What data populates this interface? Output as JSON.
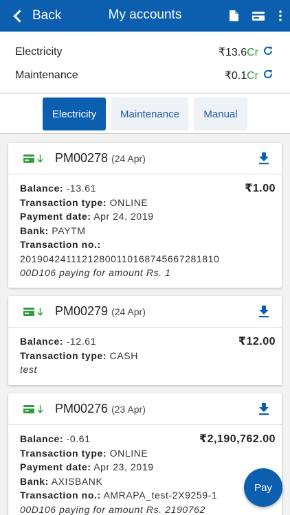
{
  "appbar": {
    "back_label": "Back",
    "title": "My accounts"
  },
  "balances": [
    {
      "label": "Electricity",
      "amount": "₹13.6",
      "suffix": "Cr"
    },
    {
      "label": "Maintenance",
      "amount": "₹0.1",
      "suffix": "Cr"
    }
  ],
  "tabs": [
    {
      "label": "Electricity",
      "active": true
    },
    {
      "label": "Maintenance",
      "active": false
    },
    {
      "label": "Manual",
      "active": false
    }
  ],
  "cards": [
    {
      "id": "PM00278",
      "date": "(24 Apr)",
      "amount": "₹1.00",
      "balance_label": "Balance:",
      "balance": "-13.61",
      "type_label": "Transaction type:",
      "type": "ONLINE",
      "date_label": "Payment date:",
      "payment_date": "Apr 24, 2019",
      "bank_label": "Bank:",
      "bank": "PAYTM",
      "txn_label": "Transaction no.:",
      "txn": "2019042411121280011016874566728181​0",
      "note": "00D106 paying for amount Rs. 1"
    },
    {
      "id": "PM00279",
      "date": "(24 Apr)",
      "amount": "₹12.00",
      "balance_label": "Balance:",
      "balance": "-12.61",
      "type_label": "Transaction type:",
      "type": "CASH",
      "note": "test"
    },
    {
      "id": "PM00276",
      "date": "(23 Apr)",
      "amount": "₹2,190,762.00",
      "balance_label": "Balance:",
      "balance": "-0.61",
      "type_label": "Transaction type:",
      "type": "ONLINE",
      "date_label": "Payment date:",
      "payment_date": "Apr 23, 2019",
      "bank_label": "Bank:",
      "bank": "AXISBANK",
      "txn_label": "Transaction no.:",
      "txn": "AMRAPA_test-2X9259-1",
      "note": "00D106 paying for amount Rs. 2190762"
    }
  ],
  "pay_label": "Pay",
  "icons": {
    "back": "chevron-left-icon",
    "document": "document-icon",
    "card": "credit-card-icon",
    "menu": "more-vert-icon",
    "refresh": "refresh-icon",
    "payment_method": "credit-card-icon",
    "direction": "arrow-down-icon",
    "download": "download-icon"
  },
  "colors": {
    "primary": "#0b5fae",
    "credit_green": "#2e9d3a",
    "tab_inactive_bg": "#eef1f5"
  }
}
